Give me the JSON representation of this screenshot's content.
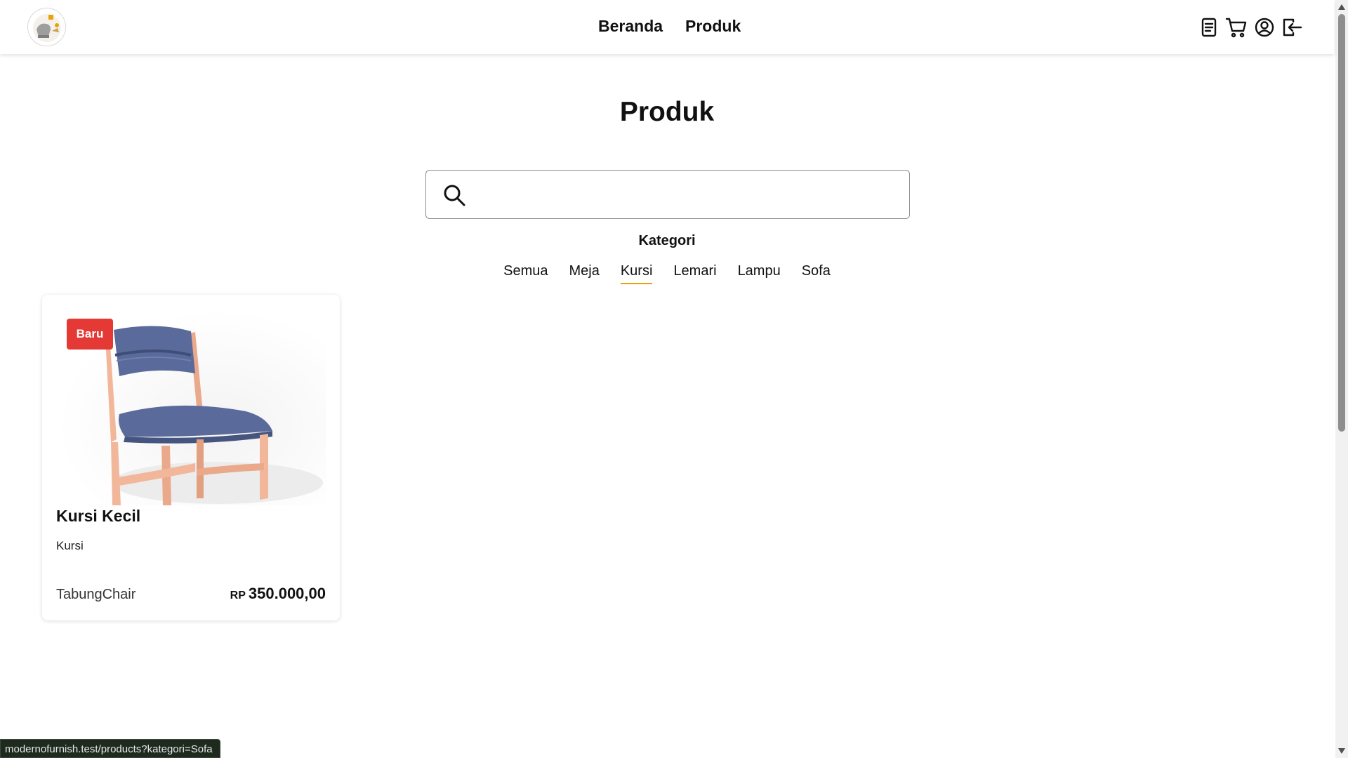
{
  "header": {
    "nav": [
      {
        "label": "Beranda"
      },
      {
        "label": "Produk"
      }
    ],
    "icons": [
      "orders-icon",
      "cart-icon",
      "profile-icon",
      "logout-icon"
    ]
  },
  "page": {
    "title": "Produk"
  },
  "search": {
    "value": "",
    "placeholder": ""
  },
  "kategori": {
    "heading": "Kategori",
    "items": [
      {
        "label": "Semua",
        "active": false
      },
      {
        "label": "Meja",
        "active": false
      },
      {
        "label": "Kursi",
        "active": true
      },
      {
        "label": "Lemari",
        "active": false
      },
      {
        "label": "Lampu",
        "active": false
      },
      {
        "label": "Sofa",
        "active": false
      }
    ],
    "active_color": "#e5a50a"
  },
  "products": [
    {
      "badge": "Baru",
      "name": "Kursi Kecil",
      "category": "Kursi",
      "brand": "TabungChair",
      "currency": "RP",
      "price": "350.000,00",
      "image": "chair-image"
    }
  ],
  "colors": {
    "badge": "#e53935",
    "chair_fabric": "#5a6a9a",
    "chair_wood": "#f2b79a"
  },
  "status_bar": {
    "url": "modernofurnish.test/products?kategori=Sofa"
  }
}
